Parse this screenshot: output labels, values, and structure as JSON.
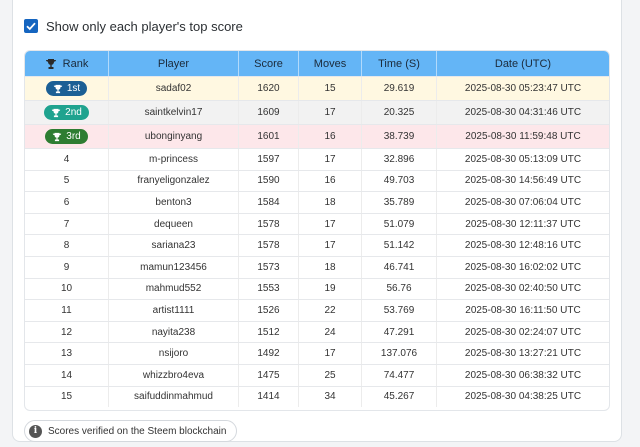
{
  "filter": {
    "label": "Show only each player's top score",
    "checked": true
  },
  "table": {
    "headers": {
      "rank": "Rank",
      "player": "Player",
      "score": "Score",
      "moves": "Moves",
      "time": "Time (S)",
      "date": "Date (UTC)"
    },
    "rows": [
      {
        "rank": "1st",
        "player": "sadaf02",
        "score": "1620",
        "moves": "15",
        "time": "29.619",
        "date": "2025-08-30 05:23:47 UTC"
      },
      {
        "rank": "2nd",
        "player": "saintkelvin17",
        "score": "1609",
        "moves": "17",
        "time": "20.325",
        "date": "2025-08-30 04:31:46 UTC"
      },
      {
        "rank": "3rd",
        "player": "ubonginyang",
        "score": "1601",
        "moves": "16",
        "time": "38.739",
        "date": "2025-08-30 11:59:48 UTC"
      },
      {
        "rank": "4",
        "player": "m-princess",
        "score": "1597",
        "moves": "17",
        "time": "32.896",
        "date": "2025-08-30 05:13:09 UTC"
      },
      {
        "rank": "5",
        "player": "franyeligonzalez",
        "score": "1590",
        "moves": "16",
        "time": "49.703",
        "date": "2025-08-30 14:56:49 UTC"
      },
      {
        "rank": "6",
        "player": "benton3",
        "score": "1584",
        "moves": "18",
        "time": "35.789",
        "date": "2025-08-30 07:06:04 UTC"
      },
      {
        "rank": "7",
        "player": "dequeen",
        "score": "1578",
        "moves": "17",
        "time": "51.079",
        "date": "2025-08-30 12:11:37 UTC"
      },
      {
        "rank": "8",
        "player": "sariana23",
        "score": "1578",
        "moves": "17",
        "time": "51.142",
        "date": "2025-08-30 12:48:16 UTC"
      },
      {
        "rank": "9",
        "player": "mamun123456",
        "score": "1573",
        "moves": "18",
        "time": "46.741",
        "date": "2025-08-30 16:02:02 UTC"
      },
      {
        "rank": "10",
        "player": "mahmud552",
        "score": "1553",
        "moves": "19",
        "time": "56.76",
        "date": "2025-08-30 02:40:50 UTC"
      },
      {
        "rank": "11",
        "player": "artist1111",
        "score": "1526",
        "moves": "22",
        "time": "53.769",
        "date": "2025-08-30 16:11:50 UTC"
      },
      {
        "rank": "12",
        "player": "nayita238",
        "score": "1512",
        "moves": "24",
        "time": "47.291",
        "date": "2025-08-30 02:24:07 UTC"
      },
      {
        "rank": "13",
        "player": "nsijoro",
        "score": "1492",
        "moves": "17",
        "time": "137.076",
        "date": "2025-08-30 13:27:21 UTC"
      },
      {
        "rank": "14",
        "player": "whizzbro4eva",
        "score": "1475",
        "moves": "25",
        "time": "74.477",
        "date": "2025-08-30 06:38:32 UTC"
      },
      {
        "rank": "15",
        "player": "saifuddinmahmud",
        "score": "1414",
        "moves": "34",
        "time": "45.267",
        "date": "2025-08-30 04:38:25 UTC"
      }
    ]
  },
  "footer": {
    "verified_text": "Scores verified on the Steem blockchain",
    "icon": "info-icon"
  },
  "colors": {
    "header": "#64b5f6",
    "checkbox": "#1565c0",
    "gold_row": "#fff8e1",
    "silver_row": "#f2f2f2",
    "bronze_row": "#fde7ea"
  }
}
